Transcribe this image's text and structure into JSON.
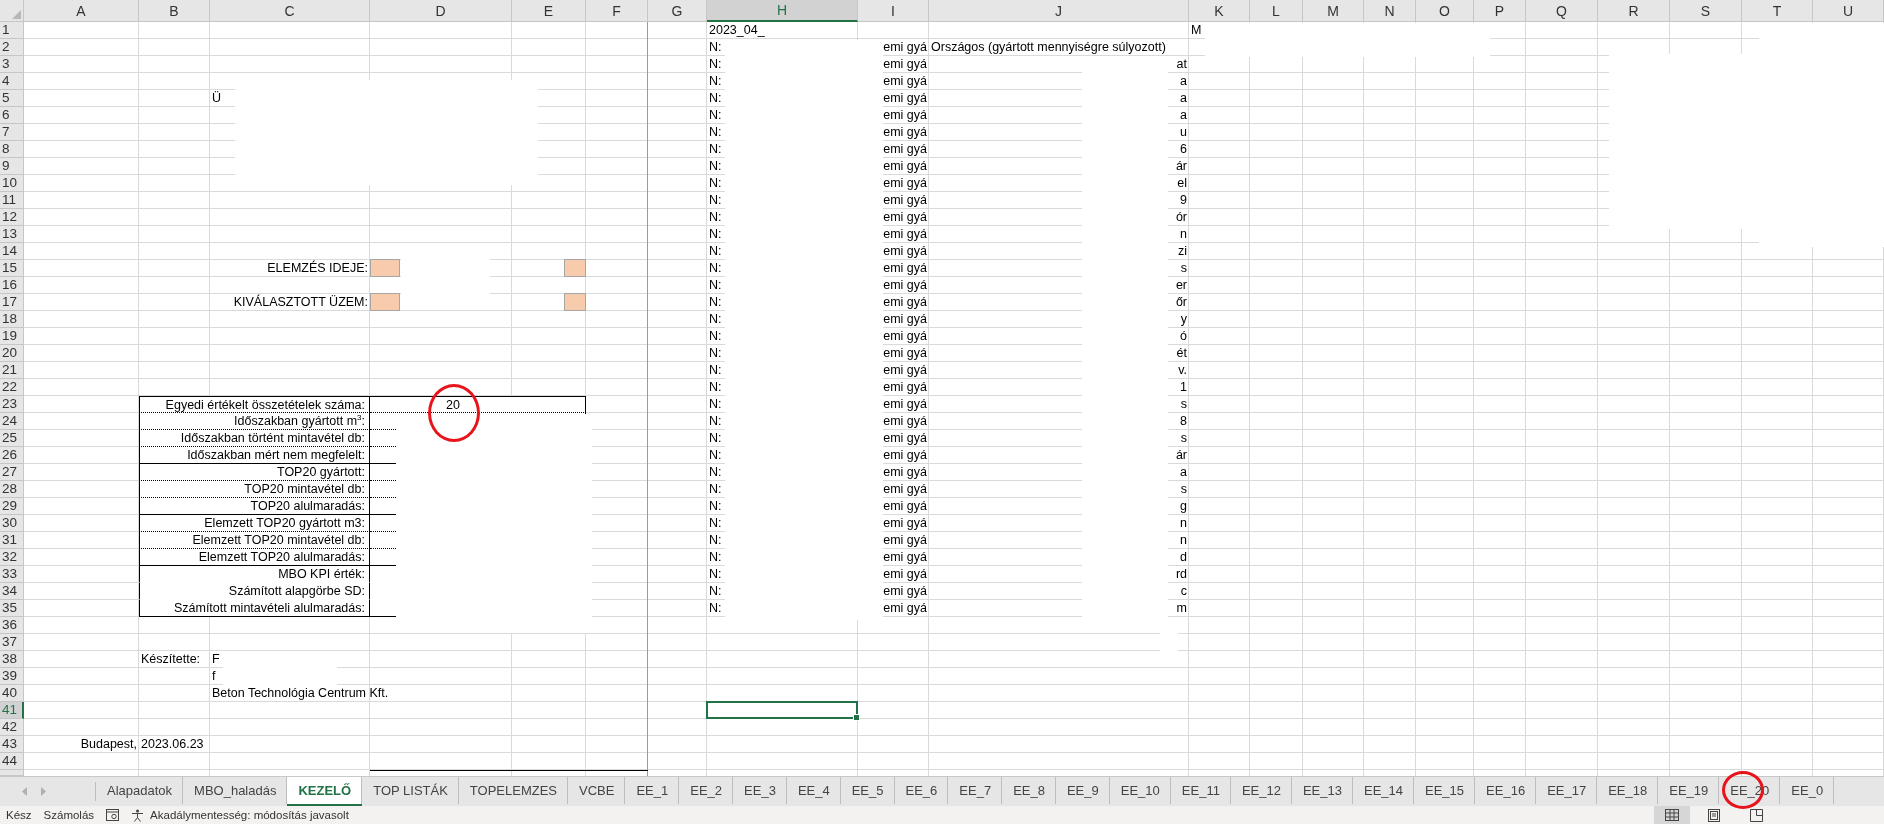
{
  "columns": [
    {
      "label": "A",
      "selected": false
    },
    {
      "label": "B",
      "selected": false
    },
    {
      "label": "C",
      "selected": false
    },
    {
      "label": "D",
      "selected": false
    },
    {
      "label": "E",
      "selected": false
    },
    {
      "label": "F",
      "selected": false
    },
    {
      "label": "G",
      "selected": false
    },
    {
      "label": "H",
      "selected": true
    },
    {
      "label": "I",
      "selected": false
    },
    {
      "label": "J",
      "selected": false
    },
    {
      "label": "K",
      "selected": false
    },
    {
      "label": "L",
      "selected": false
    },
    {
      "label": "M",
      "selected": false
    },
    {
      "label": "N",
      "selected": false
    },
    {
      "label": "O",
      "selected": false
    },
    {
      "label": "P",
      "selected": false
    },
    {
      "label": "Q",
      "selected": false
    },
    {
      "label": "R",
      "selected": false
    },
    {
      "label": "S",
      "selected": false
    },
    {
      "label": "T",
      "selected": false
    },
    {
      "label": "U",
      "selected": false
    }
  ],
  "rows": [
    {
      "label": "1",
      "selected": false,
      "cells": {
        "H": {
          "text": "2023_04_"
        },
        "K": {
          "text": "M"
        }
      }
    },
    {
      "label": "2",
      "selected": false,
      "cells": {
        "H": {
          "text": "N:"
        },
        "I": {
          "text": "emi gyá",
          "right_aligned": true
        },
        "J": {
          "text": "Országos (gyártott mennyiségre súlyozott)"
        }
      }
    },
    {
      "label": "3",
      "selected": false,
      "cells": {
        "H": {
          "text": "N:"
        },
        "I": {
          "text": "emi gyá",
          "right_aligned": true
        },
        "J": {
          "text": "at",
          "right_aligned": true
        }
      }
    },
    {
      "label": "4",
      "selected": false,
      "cells": {
        "H": {
          "text": "N:"
        },
        "I": {
          "text": "emi gyá",
          "right_aligned": true
        },
        "J": {
          "text": "a",
          "right_aligned": true
        }
      }
    },
    {
      "label": "5",
      "selected": false,
      "cells": {
        "C": {
          "text": "Ü"
        },
        "H": {
          "text": "N:"
        },
        "I": {
          "text": "emi gyá",
          "right_aligned": true
        },
        "J": {
          "text": "a",
          "right_aligned": true
        }
      }
    },
    {
      "label": "6",
      "selected": false,
      "cells": {
        "H": {
          "text": "N:"
        },
        "I": {
          "text": "emi gyá",
          "right_aligned": true
        },
        "J": {
          "text": "a",
          "right_aligned": true
        }
      }
    },
    {
      "label": "7",
      "selected": false,
      "cells": {
        "H": {
          "text": "N:"
        },
        "I": {
          "text": "emi gyá",
          "right_aligned": true
        },
        "J": {
          "text": "u",
          "right_aligned": true
        }
      }
    },
    {
      "label": "8",
      "selected": false,
      "cells": {
        "H": {
          "text": "N:"
        },
        "I": {
          "text": "emi gyá",
          "right_aligned": true
        },
        "J": {
          "text": "6",
          "right_aligned": true
        }
      }
    },
    {
      "label": "9",
      "selected": false,
      "cells": {
        "H": {
          "text": "N:"
        },
        "I": {
          "text": "emi gyá",
          "right_aligned": true
        },
        "J": {
          "text": "ár",
          "right_aligned": true
        }
      }
    },
    {
      "label": "10",
      "selected": false,
      "cells": {
        "H": {
          "text": "N:"
        },
        "I": {
          "text": "emi gyá",
          "right_aligned": true
        },
        "J": {
          "text": "el",
          "right_aligned": true
        }
      }
    },
    {
      "label": "11",
      "selected": false,
      "cells": {
        "H": {
          "text": "N:"
        },
        "I": {
          "text": "emi gyá",
          "right_aligned": true
        },
        "J": {
          "text": "9",
          "right_aligned": true
        }
      }
    },
    {
      "label": "12",
      "selected": false,
      "cells": {
        "H": {
          "text": "N:"
        },
        "I": {
          "text": "emi gyá",
          "right_aligned": true
        },
        "J": {
          "text": "ór",
          "right_aligned": true
        }
      }
    },
    {
      "label": "13",
      "selected": false,
      "cells": {
        "H": {
          "text": "N:"
        },
        "I": {
          "text": "emi gyá",
          "right_aligned": true
        },
        "J": {
          "text": "n",
          "right_aligned": true
        }
      }
    },
    {
      "label": "14",
      "selected": false,
      "cells": {
        "H": {
          "text": "N:"
        },
        "I": {
          "text": "emi gyá",
          "right_aligned": true
        },
        "J": {
          "text": "zi",
          "right_aligned": true
        }
      }
    },
    {
      "label": "15",
      "selected": false,
      "cells": {
        "C": {
          "text": "ELEMZÉS IDEJE:",
          "right_aligned": true
        },
        "D": {
          "shaded": true
        },
        "E": {
          "shaded": true
        },
        "H": {
          "text": "N:"
        },
        "I": {
          "text": "emi gyá",
          "right_aligned": true
        },
        "J": {
          "text": "s",
          "right_aligned": true
        }
      }
    },
    {
      "label": "16",
      "selected": false,
      "cells": {
        "H": {
          "text": "N:"
        },
        "I": {
          "text": "emi gyá",
          "right_aligned": true
        },
        "J": {
          "text": "er",
          "right_aligned": true
        }
      }
    },
    {
      "label": "17",
      "selected": false,
      "cells": {
        "C": {
          "text": "KIVÁLASZTOTT ÜZEM:",
          "right_aligned": true
        },
        "D": {
          "shaded": true
        },
        "E": {
          "shaded": true
        },
        "H": {
          "text": "N:"
        },
        "I": {
          "text": "emi gyá",
          "right_aligned": true
        },
        "J": {
          "text": "őr",
          "right_aligned": true
        }
      }
    },
    {
      "label": "18",
      "selected": false,
      "cells": {
        "H": {
          "text": "N:"
        },
        "I": {
          "text": "emi gyá",
          "right_aligned": true
        },
        "J": {
          "text": "y",
          "right_aligned": true
        }
      }
    },
    {
      "label": "19",
      "selected": false,
      "cells": {
        "H": {
          "text": "N:"
        },
        "I": {
          "text": "emi gyá",
          "right_aligned": true
        },
        "J": {
          "text": "ó",
          "right_aligned": true
        }
      }
    },
    {
      "label": "20",
      "selected": false,
      "cells": {
        "H": {
          "text": "N:"
        },
        "I": {
          "text": "emi gyá",
          "right_aligned": true
        },
        "J": {
          "text": "ét",
          "right_aligned": true
        }
      }
    },
    {
      "label": "21",
      "selected": false,
      "cells": {
        "H": {
          "text": "N:"
        },
        "I": {
          "text": "emi gyá",
          "right_aligned": true
        },
        "J": {
          "text": "v.",
          "right_aligned": true
        }
      }
    },
    {
      "label": "22",
      "selected": false,
      "cells": {
        "H": {
          "text": "N:"
        },
        "I": {
          "text": "emi gyá",
          "right_aligned": true
        },
        "J": {
          "text": "1",
          "right_aligned": true
        }
      }
    },
    {
      "label": "23",
      "selected": false,
      "cells": {
        "H": {
          "text": "N:"
        },
        "I": {
          "text": "emi gyá",
          "right_aligned": true
        },
        "J": {
          "text": "s",
          "right_aligned": true
        }
      }
    },
    {
      "label": "24",
      "selected": false,
      "cells": {
        "H": {
          "text": "N:"
        },
        "I": {
          "text": "emi gyá",
          "right_aligned": true
        },
        "J": {
          "text": "8",
          "right_aligned": true
        }
      }
    },
    {
      "label": "25",
      "selected": false,
      "cells": {
        "H": {
          "text": "N:"
        },
        "I": {
          "text": "emi gyá",
          "right_aligned": true
        },
        "J": {
          "text": "s",
          "right_aligned": true
        }
      }
    },
    {
      "label": "26",
      "selected": false,
      "cells": {
        "H": {
          "text": "N:"
        },
        "I": {
          "text": "emi gyá",
          "right_aligned": true
        },
        "J": {
          "text": "ár",
          "right_aligned": true
        }
      }
    },
    {
      "label": "27",
      "selected": false,
      "cells": {
        "H": {
          "text": "N:"
        },
        "I": {
          "text": "emi gyá",
          "right_aligned": true
        },
        "J": {
          "text": "a",
          "right_aligned": true
        }
      }
    },
    {
      "label": "28",
      "selected": false,
      "cells": {
        "H": {
          "text": "N:"
        },
        "I": {
          "text": "emi gyá",
          "right_aligned": true
        },
        "J": {
          "text": "s",
          "right_aligned": true
        }
      }
    },
    {
      "label": "29",
      "selected": false,
      "cells": {
        "H": {
          "text": "N:"
        },
        "I": {
          "text": "emi gyá",
          "right_aligned": true
        },
        "J": {
          "text": "g",
          "right_aligned": true
        }
      }
    },
    {
      "label": "30",
      "selected": false,
      "cells": {
        "H": {
          "text": "N:"
        },
        "I": {
          "text": "emi gyá",
          "right_aligned": true
        },
        "J": {
          "text": "n",
          "right_aligned": true
        }
      }
    },
    {
      "label": "31",
      "selected": false,
      "cells": {
        "H": {
          "text": "N:"
        },
        "I": {
          "text": "emi gyá",
          "right_aligned": true
        },
        "J": {
          "text": "n",
          "right_aligned": true
        }
      }
    },
    {
      "label": "32",
      "selected": false,
      "cells": {
        "H": {
          "text": "N:"
        },
        "I": {
          "text": "emi gyá",
          "right_aligned": true
        },
        "J": {
          "text": "d",
          "right_aligned": true
        }
      }
    },
    {
      "label": "33",
      "selected": false,
      "cells": {
        "H": {
          "text": "N:"
        },
        "I": {
          "text": "emi gyá",
          "right_aligned": true
        },
        "J": {
          "text": "rd",
          "right_aligned": true
        }
      }
    },
    {
      "label": "34",
      "selected": false,
      "cells": {
        "H": {
          "text": "N:"
        },
        "I": {
          "text": "emi gyá",
          "right_aligned": true
        },
        "J": {
          "text": "c",
          "right_aligned": true
        }
      }
    },
    {
      "label": "35",
      "selected": false,
      "cells": {
        "H": {
          "text": "N:"
        },
        "I": {
          "text": "emi gyá",
          "right_aligned": true
        },
        "J": {
          "text": "m",
          "right_aligned": true
        }
      }
    },
    {
      "label": "36",
      "selected": false
    },
    {
      "label": "37",
      "selected": false
    },
    {
      "label": "38",
      "selected": false,
      "cells": {
        "B": {
          "text": "Készítette:"
        },
        "C": {
          "text": "F"
        }
      }
    },
    {
      "label": "39",
      "selected": false,
      "cells": {
        "C": {
          "text": "f"
        }
      }
    },
    {
      "label": "40",
      "selected": false,
      "cells": {
        "C": {
          "text": "Beton Technológia Centrum Kft."
        }
      }
    },
    {
      "label": "41",
      "selected": true
    },
    {
      "label": "42",
      "selected": false
    },
    {
      "label": "43",
      "selected": false,
      "cells": {
        "A": {
          "text": "Budapest,",
          "right_aligned": true
        },
        "B": {
          "text": "2023.06.23"
        }
      }
    },
    {
      "label": "44",
      "selected": false
    }
  ],
  "summary_table": {
    "rows": [
      {
        "label": "Egyedi értékelt összetételek száma:",
        "value": "20",
        "circled": true,
        "kind": "dotted"
      },
      {
        "label": "Időszakban gyártott m$^{3}$:",
        "circled": false,
        "kind": "dotted"
      },
      {
        "label": "Időszakban történt mintavétel db:",
        "circled": false,
        "kind": "dotted"
      },
      {
        "label": "Időszakban mért nem megfelelt:",
        "circled": false,
        "kind": "solid"
      },
      {
        "label": "TOP20 gyártott:",
        "circled": false,
        "kind": "dotted"
      },
      {
        "label": "TOP20 mintavétel db:",
        "circled": false,
        "kind": "dotted"
      },
      {
        "label": "TOP20 alulmaradás:",
        "circled": false,
        "kind": "solid"
      },
      {
        "label": "Elemzett TOP20 gyártott m3:",
        "circled": false,
        "kind": "dotted"
      },
      {
        "label": "Elemzett TOP20 mintavétel db:",
        "circled": false,
        "kind": "dotted"
      },
      {
        "label": "Elemzett TOP20 alulmaradás:",
        "circled": false,
        "kind": "solid"
      },
      {
        "label": "MBO KPI érték:",
        "circled": false,
        "kind": "plain"
      },
      {
        "label": "Számított alapgörbe SD:",
        "circled": false,
        "kind": "plain"
      },
      {
        "label": "Számított mintavételi alulmaradás:",
        "circled": false,
        "kind": "solid"
      }
    ]
  },
  "sheet_tabs": [
    {
      "label": "Alapadatok",
      "selected": false,
      "circled": false
    },
    {
      "label": "MBO_haladás",
      "selected": false,
      "circled": false
    },
    {
      "label": "KEZELŐ",
      "selected": true,
      "circled": false
    },
    {
      "label": "TOP LISTÁK",
      "selected": false,
      "circled": false
    },
    {
      "label": "TOPELEMZES",
      "selected": false,
      "circled": false
    },
    {
      "label": "VCBE",
      "selected": false,
      "circled": false
    },
    {
      "label": "EE_1",
      "selected": false,
      "circled": false
    },
    {
      "label": "EE_2",
      "selected": false,
      "circled": false
    },
    {
      "label": "EE_3",
      "selected": false,
      "circled": false
    },
    {
      "label": "EE_4",
      "selected": false,
      "circled": false
    },
    {
      "label": "EE_5",
      "selected": false,
      "circled": false
    },
    {
      "label": "EE_6",
      "selected": false,
      "circled": false
    },
    {
      "label": "EE_7",
      "selected": false,
      "circled": false
    },
    {
      "label": "EE_8",
      "selected": false,
      "circled": false
    },
    {
      "label": "EE_9",
      "selected": false,
      "circled": false
    },
    {
      "label": "EE_10",
      "selected": false,
      "circled": false
    },
    {
      "label": "EE_11",
      "selected": false,
      "circled": false
    },
    {
      "label": "EE_12",
      "selected": false,
      "circled": false
    },
    {
      "label": "EE_13",
      "selected": false,
      "circled": false
    },
    {
      "label": "EE_14",
      "selected": false,
      "circled": false
    },
    {
      "label": "EE_15",
      "selected": false,
      "circled": false
    },
    {
      "label": "EE_16",
      "selected": false,
      "circled": false
    },
    {
      "label": "EE_17",
      "selected": false,
      "circled": false
    },
    {
      "label": "EE_18",
      "selected": false,
      "circled": false
    },
    {
      "label": "EE_19",
      "selected": false,
      "circled": false
    },
    {
      "label": "EE_20",
      "selected": false,
      "circled": true
    },
    {
      "label": "EE_0",
      "selected": false,
      "circled": false
    }
  ],
  "status_bar": {
    "items": [
      {
        "kind": "text",
        "label": "Kész"
      },
      {
        "kind": "text",
        "label": "Számolás"
      },
      {
        "kind": "macro"
      },
      {
        "kind": "accessibility",
        "label": "Akadálymentesség: módosítás javasolt"
      }
    ],
    "views": [
      {
        "kind": "normal",
        "selected": true
      },
      {
        "kind": "page-layout",
        "selected": false
      },
      {
        "kind": "page-break",
        "selected": false
      }
    ]
  }
}
